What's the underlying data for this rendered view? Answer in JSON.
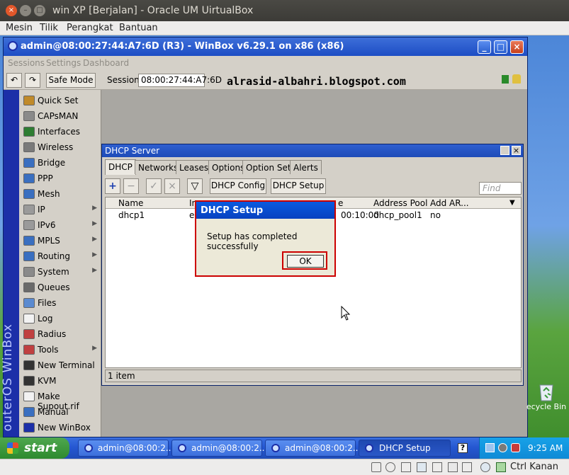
{
  "vbox": {
    "title": "win XP [Berjalan] - Oracle UM UirtualBox",
    "menu": [
      "Mesin",
      "Tilik",
      "Perangkat",
      "Bantuan"
    ],
    "host_key": "Ctrl Kanan"
  },
  "winbox": {
    "title": "admin@08:00:27:44:A7:6D (R3) - WinBox v6.29.1 on x86 (x86)",
    "menu": [
      "Sessions",
      "Settings",
      "Dashboard"
    ],
    "safe_mode": "Safe Mode",
    "session_label": "Session:",
    "session_value": "08:00:27:44:A7:6D",
    "brand": "outerOS WinBox",
    "sidebar": [
      {
        "label": "Quick Set",
        "icon": "quick-set-icon",
        "color": "#c08a2a",
        "arrow": false
      },
      {
        "label": "CAPsMAN",
        "icon": "capsman-icon",
        "color": "#8a8a8a",
        "arrow": false
      },
      {
        "label": "Interfaces",
        "icon": "interfaces-icon",
        "color": "#2e7d32",
        "arrow": false
      },
      {
        "label": "Wireless",
        "icon": "wireless-icon",
        "color": "#7a7a7a",
        "arrow": false
      },
      {
        "label": "Bridge",
        "icon": "bridge-icon",
        "color": "#3a6fc0",
        "arrow": false
      },
      {
        "label": "PPP",
        "icon": "ppp-icon",
        "color": "#3a6fc0",
        "arrow": false
      },
      {
        "label": "Mesh",
        "icon": "mesh-icon",
        "color": "#3a6fc0",
        "arrow": false
      },
      {
        "label": "IP",
        "icon": "ip-icon",
        "color": "#9a9a9a",
        "arrow": true
      },
      {
        "label": "IPv6",
        "icon": "ipv6-icon",
        "color": "#9a9a9a",
        "arrow": true
      },
      {
        "label": "MPLS",
        "icon": "mpls-icon",
        "color": "#3a6fc0",
        "arrow": true
      },
      {
        "label": "Routing",
        "icon": "routing-icon",
        "color": "#3a6fc0",
        "arrow": true
      },
      {
        "label": "System",
        "icon": "system-icon",
        "color": "#8a8a8a",
        "arrow": true
      },
      {
        "label": "Queues",
        "icon": "queues-icon",
        "color": "#6a6a6a",
        "arrow": false
      },
      {
        "label": "Files",
        "icon": "files-icon",
        "color": "#5a8ad0",
        "arrow": false
      },
      {
        "label": "Log",
        "icon": "log-icon",
        "color": "#f2f2f2",
        "arrow": false
      },
      {
        "label": "Radius",
        "icon": "radius-icon",
        "color": "#c04040",
        "arrow": false
      },
      {
        "label": "Tools",
        "icon": "tools-icon",
        "color": "#c04040",
        "arrow": true
      },
      {
        "label": "New Terminal",
        "icon": "terminal-icon",
        "color": "#333333",
        "arrow": false
      },
      {
        "label": "KVM",
        "icon": "kvm-icon",
        "color": "#333333",
        "arrow": false
      },
      {
        "label": "Make Supout.rif",
        "icon": "supout-icon",
        "color": "#f2f2f2",
        "arrow": false
      },
      {
        "label": "Manual",
        "icon": "manual-icon",
        "color": "#3a6fc0",
        "arrow": false
      },
      {
        "label": "New WinBox",
        "icon": "winbox-icon",
        "color": "#1c2fa8",
        "arrow": false
      }
    ]
  },
  "banner": "alrasid-albahri.blogspot.com",
  "dhcp": {
    "title": "DHCP Server",
    "tabs": [
      "DHCP",
      "Networks",
      "Leases",
      "Options",
      "Option Sets",
      "Alerts"
    ],
    "config_btn": "DHCP Config",
    "setup_btn": "DHCP Setup",
    "find_placeholder": "Find",
    "columns": [
      "Name",
      "In",
      "e",
      "Address Pool",
      "Add AR..."
    ],
    "row": {
      "name": "dhcp1",
      "interface": "e",
      "lease": "00:10:00",
      "pool": "dhcp_pool1",
      "add_arp": "no"
    },
    "status": "1 item"
  },
  "dialog": {
    "title": "DHCP Setup",
    "message": "Setup has completed successfully",
    "ok": "OK"
  },
  "desktop": {
    "recycle_label": "ecycle Bin"
  },
  "taskbar": {
    "start": "start",
    "tasks": [
      "admin@08:00:2...",
      "admin@08:00:2...",
      "admin@08:00:2...",
      "DHCP Setup"
    ],
    "clock": "9:25 AM"
  }
}
